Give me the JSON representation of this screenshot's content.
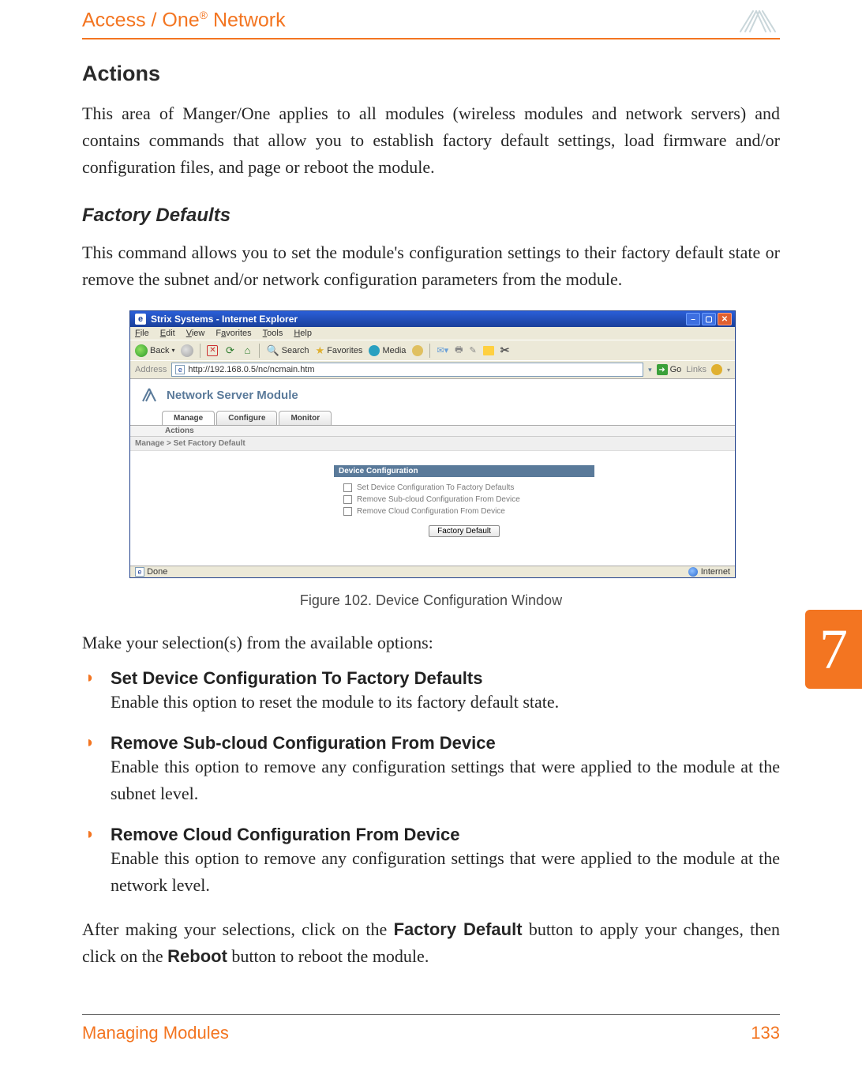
{
  "header": {
    "brand_pre": "Access / One",
    "brand_sup": "®",
    "brand_post": " Network"
  },
  "section_title": "Actions",
  "intro_para": "This area of Manger/One applies to all modules (wireless modules and network servers) and contains commands that allow you to establish factory default settings, load firmware and/or configuration files, and page or reboot the module.",
  "subsection_title": "Factory Defaults",
  "sub_intro": "This command allows you to set the module's configuration settings to their factory default state or remove the subnet and/or network configuration parameters from the module.",
  "ie": {
    "title": "Strix Systems - Internet Explorer",
    "menu": [
      "File",
      "Edit",
      "View",
      "Favorites",
      "Tools",
      "Help"
    ],
    "tb": {
      "back": "Back",
      "search": "Search",
      "favorites": "Favorites",
      "media": "Media"
    },
    "addr_label": "Address",
    "addr_value": "http://192.168.0.5/nc/ncmain.htm",
    "go": "Go",
    "links": "Links",
    "module_title": "Network Server Module",
    "tabs": [
      "Manage",
      "Configure",
      "Monitor"
    ],
    "subtab": "Actions",
    "breadcrumb": "Manage > Set Factory Default",
    "panel_title": "Device Configuration",
    "check1": "Set Device Configuration To Factory Defaults",
    "check2": "Remove Sub-cloud Configuration From Device",
    "check3": "Remove Cloud Configuration From Device",
    "button": "Factory Default",
    "status_left": "Done",
    "status_right": "Internet"
  },
  "figure_caption": "Figure 102. Device Configuration Window",
  "make_selection": "Make your selection(s) from the available options:",
  "options": [
    {
      "title": "Set Device Configuration To Factory Defaults",
      "desc": "Enable this option to reset the module to its factory default state."
    },
    {
      "title": "Remove Sub-cloud Configuration From Device",
      "desc": "Enable this option to remove any configuration settings that were applied to the module at the subnet level."
    },
    {
      "title": "Remove Cloud Configuration From Device",
      "desc": "Enable this option to remove any configuration settings that were applied to the module at the network level."
    }
  ],
  "after_para_pre": "After making your selections, click on the ",
  "after_para_btn1": "Factory Default",
  "after_para_mid": " button to apply your changes, then click on the ",
  "after_para_btn2": "Reboot",
  "after_para_post": " button to reboot the module.",
  "chapter": "7",
  "footer_left": "Managing Modules",
  "footer_right": "133"
}
